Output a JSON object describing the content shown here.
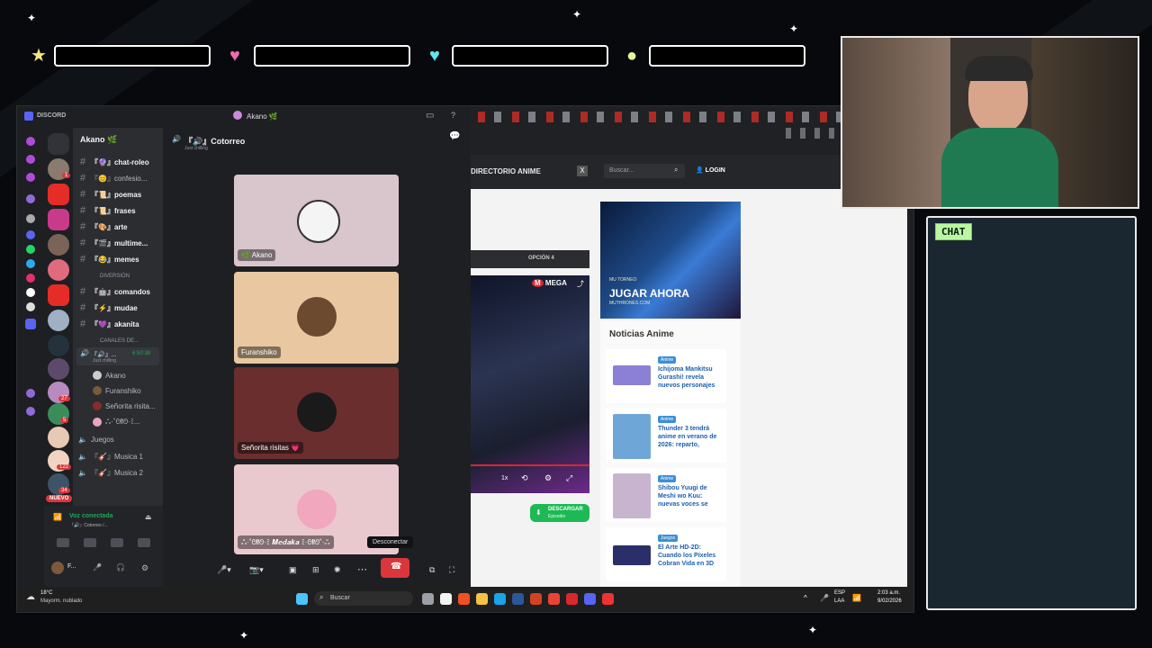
{
  "overlay": {
    "bars": [
      "",
      "",
      "",
      ""
    ],
    "chat_label": "CHAT"
  },
  "discord": {
    "app_name": "DISCORD",
    "window_user": "Akano 🌿",
    "server_name": "Akano 🌿",
    "voice_channel_title": "『🔊』Cotorreo",
    "voice_channel_status": "Just chilling",
    "channels": [
      {
        "icon": "#",
        "label": "『🔮』chat-roleo"
      },
      {
        "icon": "#",
        "label": "『😊』confesio..."
      },
      {
        "icon": "#",
        "label": "『📜』poemas"
      },
      {
        "icon": "#",
        "label": "『📜』frases"
      },
      {
        "icon": "#",
        "label": "『🎨』arte"
      },
      {
        "icon": "#",
        "label": "『🎬』multime..."
      },
      {
        "icon": "#",
        "label": "『😂』memes"
      }
    ],
    "category_fun": "DIVERSIÓN",
    "channels_fun": [
      {
        "icon": "#",
        "label": "『🤖』comandos"
      },
      {
        "icon": "#",
        "label": "『⚡』mudae"
      },
      {
        "icon": "#",
        "label": "『💜』akanita"
      }
    ],
    "category_voice": "CANALES DE...",
    "active_voice": {
      "label": "『🔊』...",
      "time": "6:50:38",
      "status": "Just chilling"
    },
    "voice_members": [
      "Akano",
      "Furanshiko",
      "Señorita risita...",
      "ஃ·˚ᘛᘚ·ﾐ..."
    ],
    "voice_channels": [
      {
        "label": "Juegos"
      },
      {
        "label": "『🎸』Musica 1"
      },
      {
        "label": "『🎸』Musica 2"
      }
    ],
    "new_badge": "NUEVO",
    "guild_badges": [
      "1",
      "27",
      "5",
      "122",
      "34"
    ],
    "connection_status": "Voz conectada",
    "connection_detail": "『🔊』Cotorreo /...",
    "user_short": "F...",
    "tiles": [
      {
        "name": "🌿 Akano"
      },
      {
        "name": "Furanshiko"
      },
      {
        "name": "Señorita risitas 💗"
      },
      {
        "name": "ஃ·˚ᘛᘚ·ﾐ 𝑴𝒆𝒅𝒂𝒌𝒂 ﾐ·ᘛᘚ˚·ஃ"
      }
    ],
    "tooltip_disconnect": "Desconectar"
  },
  "browser": {
    "nav_directory": "DIRECTORIO ANIME",
    "search_placeholder": "Buscar...",
    "login_label": "LOGIN",
    "option_label": "OPCIÓN 4",
    "player_brand": "MEGA",
    "player_speed": "1x",
    "download_label": "DESCARGAR",
    "download_sub": "Episodio",
    "ad_game": "MU TORNEO",
    "ad_cta": "JUGAR AHORA",
    "ad_url": "MUTHRONES.COM",
    "news_title": "Noticias Anime",
    "news": [
      {
        "badge": "Anime",
        "title": "Ichijoma Mankitsu Gurashi! revela nuevos personajes",
        "color": "#8c7fd6"
      },
      {
        "badge": "Anime",
        "title": "Thunder 3 tendrá anime en verano de 2026: reparto,",
        "color": "#6fa6d8"
      },
      {
        "badge": "Anime",
        "title": "Shibou Yuugi de Meshi wo Kuu: nuevas voces se",
        "color": "#c9b4cf"
      },
      {
        "badge": "Juegos",
        "title": "El Arte HD-2D: Cuando los Píxeles Cobran Vida en 3D",
        "color": "#2a2f6a"
      }
    ]
  },
  "taskbar": {
    "weather_temp": "18°C",
    "weather_desc": "Mayorm. nublado",
    "search_label": "Buscar",
    "lang": "ESP",
    "lang_sub": "LAA",
    "time": "2:03 a.m.",
    "date": "9/02/2026"
  },
  "colors": {
    "discord_bg": "#1e1f22",
    "accent_green": "#23a55a",
    "disconnect_red": "#da373c",
    "link_blue": "#1d5fb0",
    "download_green": "#1db954"
  }
}
